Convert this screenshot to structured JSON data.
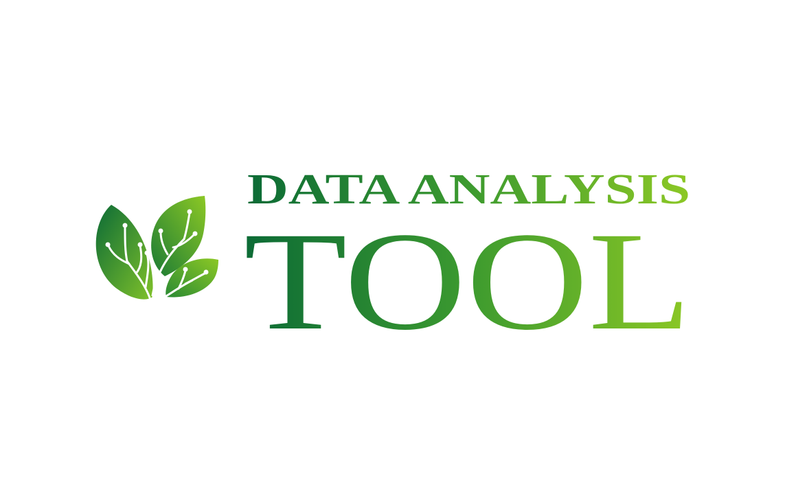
{
  "logo": {
    "line1": "DATA ANALYSIS",
    "line2": "TOOL"
  },
  "colors": {
    "dark_green": "#0c6b36",
    "mid_green": "#3c9a2f",
    "light_green": "#8cc825",
    "background": "#ffffff"
  },
  "icons": {
    "mark": "leaves-network-icon"
  }
}
